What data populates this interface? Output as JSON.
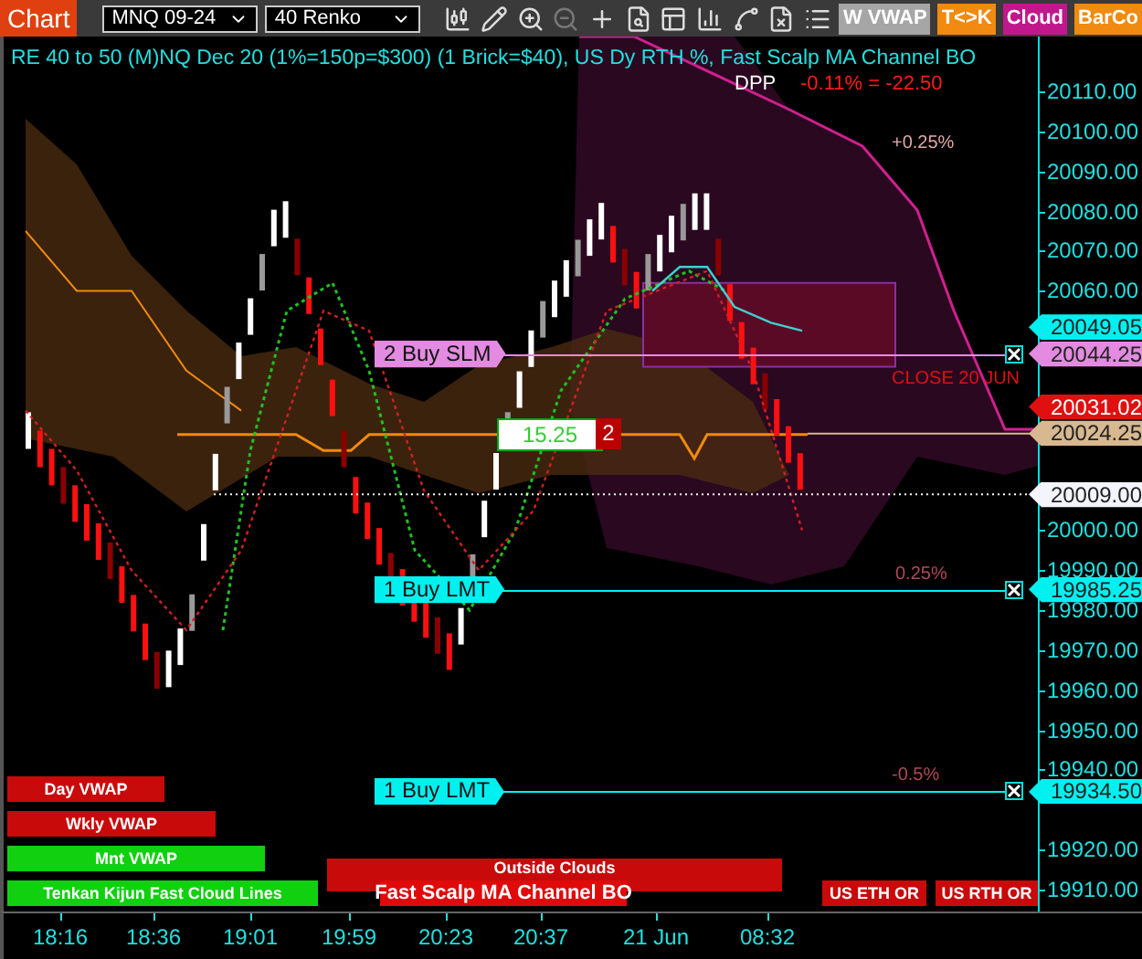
{
  "toolbar": {
    "title": "Chart",
    "instrument": {
      "value": "MNQ 09-24"
    },
    "bar_type": {
      "value": "40 Renko"
    },
    "tools": [
      {
        "kind": "candles",
        "disabled": false
      },
      {
        "kind": "pencil",
        "disabled": false
      },
      {
        "kind": "zoom_in",
        "disabled": false
      },
      {
        "kind": "zoom_out",
        "disabled": true
      },
      {
        "kind": "crosshair",
        "disabled": false
      },
      {
        "kind": "data_box",
        "disabled": false
      },
      {
        "kind": "template",
        "disabled": false
      },
      {
        "kind": "columns",
        "disabled": false
      },
      {
        "kind": "indicator",
        "disabled": false
      },
      {
        "kind": "strategy",
        "disabled": false
      },
      {
        "kind": "list",
        "disabled": false
      }
    ],
    "buttons": [
      {
        "label": "W VWAP",
        "color": "#a6a6a6"
      },
      {
        "label": "T<>K",
        "color": "#f08a10"
      },
      {
        "label": "Cloud",
        "color": "#c0188c"
      },
      {
        "label": "BarCo",
        "color": "#f08a10"
      }
    ]
  },
  "chart": {
    "header": "RE 40 to 50 (M)NQ Dec 20 (1%=150p=$300) (1 Brick=$40), US Dy RTH %, Fast Scalp MA Channel BO",
    "dpp": "DPP",
    "change": "-0.11% = -22.50",
    "annotations": [
      "+0.25%",
      "CLOSE 20 JUN",
      "0.25%",
      "-0.5%"
    ],
    "position": {
      "price": "15.25",
      "quantity": "2"
    },
    "orders": [
      {
        "label": "2 Buy SLM",
        "price": "20044.25",
        "color": "#e38be0"
      },
      {
        "label": "1 Buy LMT",
        "price": "19985.25",
        "color": "#00f0f0"
      },
      {
        "label": "1 Buy LMT",
        "price": "19934.50",
        "color": "#00f0f0"
      }
    ],
    "legend": [
      {
        "label": "Day VWAP",
        "color": "#c80a0a"
      },
      {
        "label": "Wkly VWAP",
        "color": "#c80a0a"
      },
      {
        "label": "Mnt VWAP",
        "color": "#10d010"
      },
      {
        "label": "Tenkan Kijun Fast Cloud Lines",
        "color": "#10d010"
      },
      {
        "label": "Outside Clouds",
        "color": "#c80a0a"
      },
      {
        "label": "Fast Scalp MA Channel BO",
        "color": "#e00a0a"
      },
      {
        "label": "US ETH OR",
        "color": "#c80a0a"
      },
      {
        "label": "US RTH OR",
        "color": "#c80a0a"
      }
    ]
  },
  "price_axis": {
    "ticks": [
      "20110.00",
      "20100.00",
      "20090.00",
      "20080.00",
      "20070.00",
      "20060.00",
      "20000.00",
      "19990.00",
      "19980.00",
      "19970.00",
      "19960.00",
      "19950.00",
      "19940.00",
      "19920.00",
      "19910.00"
    ],
    "markers": [
      {
        "price": "20049.05",
        "color": "#00f0f0"
      },
      {
        "price": "20031.02",
        "color": "#e01010"
      },
      {
        "price": "20024.25",
        "color": "#d8b890"
      },
      {
        "price": "20009.00",
        "color": "#f4f4ff"
      }
    ]
  },
  "time_axis": {
    "labels": [
      "18:16",
      "18:36",
      "19:01",
      "19:59",
      "20:23",
      "20:37",
      "21 Jun",
      "08:32"
    ]
  }
}
